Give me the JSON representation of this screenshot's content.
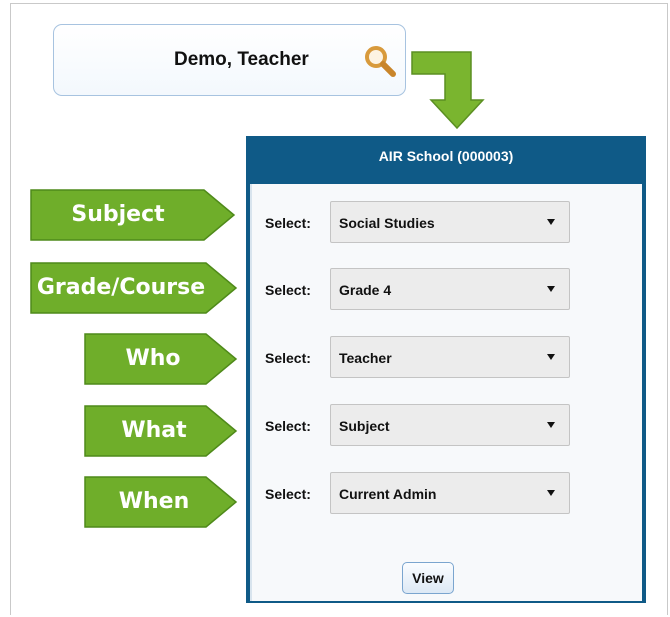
{
  "user": {
    "name": "Demo, Teacher",
    "icon": "search-icon"
  },
  "panel": {
    "title": "AIR School (000003)",
    "rows": [
      {
        "label": "Select:",
        "value": "Social Studies"
      },
      {
        "label": "Select:",
        "value": "Grade 4"
      },
      {
        "label": "Select:",
        "value": "Teacher"
      },
      {
        "label": "Select:",
        "value": "Subject"
      },
      {
        "label": "Select:",
        "value": "Current Admin"
      }
    ],
    "view_label": "View"
  },
  "tags": [
    "Subject",
    "Grade/Course",
    "Who",
    "What",
    "When"
  ],
  "colors": {
    "panel_header": "#0f5a87",
    "tag_green": "#6fae2a",
    "arrow_green": "#7ab52f"
  }
}
